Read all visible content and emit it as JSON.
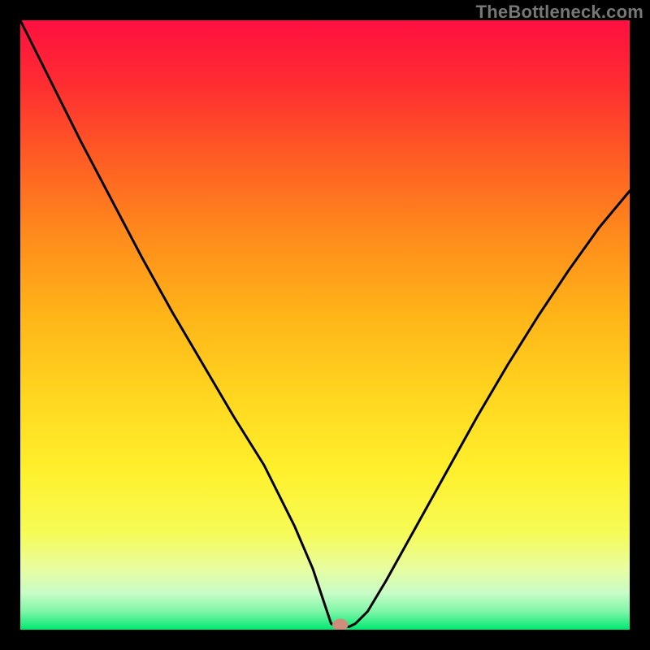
{
  "watermark": "TheBottleneck.com",
  "chart_data": {
    "type": "line",
    "title": "",
    "xlabel": "",
    "ylabel": "",
    "xlim": [
      0,
      100
    ],
    "ylim": [
      0,
      100
    ],
    "grid": false,
    "legend": false,
    "background_gradient": {
      "top": "#ff1040",
      "mid": "#ffd720",
      "bottom": "#00e870"
    },
    "series": [
      {
        "name": "bottleneck-curve",
        "color": "#000000",
        "x": [
          0,
          5,
          10,
          15,
          20,
          25,
          30,
          35,
          40,
          45,
          48,
          50,
          51,
          52,
          54,
          55,
          57,
          60,
          65,
          70,
          75,
          80,
          85,
          90,
          95,
          100
        ],
        "y": [
          100,
          90,
          80,
          70.5,
          61,
          52,
          43.5,
          35,
          27,
          17,
          10,
          4,
          1,
          0.5,
          0.5,
          1,
          3,
          8,
          17,
          26,
          35,
          43.5,
          51.5,
          59,
          66,
          72
        ]
      }
    ],
    "annotations": [
      {
        "name": "marker-dot",
        "shape": "ellipse",
        "cx": 52.5,
        "cy": 0.8,
        "rx": 1.3,
        "ry": 1.0,
        "fill": "#cf8d7b"
      }
    ]
  }
}
